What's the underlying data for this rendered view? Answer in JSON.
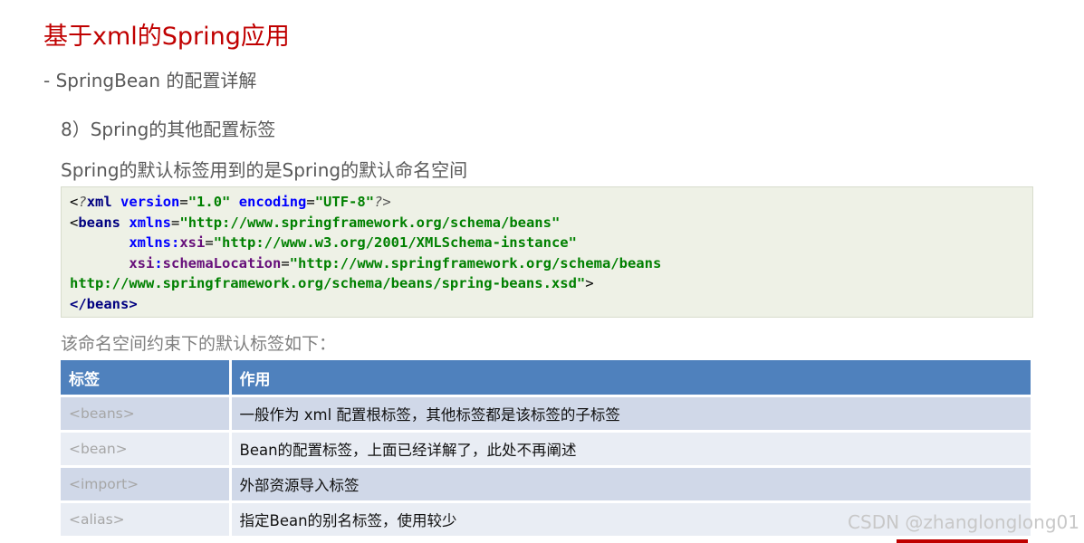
{
  "title": "基于xml的Spring应用",
  "subtitle": "- SpringBean 的配置详解",
  "section_item": "8）Spring的其他配置标签",
  "description": "Spring的默认标签用到的是Spring的默认命名空间",
  "code": {
    "line1": {
      "open": "<",
      "pi": "?",
      "name": "xml",
      "attr1": "version",
      "val1": "\"1.0\"",
      "attr2": "encoding",
      "val2": "\"UTF-8\"",
      "close": "?>"
    },
    "line2": {
      "open": "<",
      "name": "beans",
      "attr": "xmlns",
      "eq": "=",
      "val": "\"http://www.springframework.org/schema/beans\""
    },
    "line3": {
      "indent": "       ",
      "prefix": "xmlns",
      "colon": ":",
      "local": "xsi",
      "eq": "=",
      "val": "\"http://www.w3.org/2001/XMLSchema-instance\""
    },
    "line4": {
      "indent": "       ",
      "prefix": "xsi",
      "colon": ":",
      "local": "schemaLocation",
      "eq": "=",
      "val": "\"http://www.springframework.org/schema/beans"
    },
    "line5": {
      "val": "http://www.springframework.org/schema/beans/spring-beans.xsd\"",
      "close": ">"
    },
    "line6": {
      "tag": "</beans>"
    }
  },
  "table_caption": "该命名空间约束下的默认标签如下：",
  "table": {
    "headers": [
      "标签",
      "作用"
    ],
    "rows": [
      [
        "<beans>",
        "一般作为 xml 配置根标签，其他标签都是该标签的子标签"
      ],
      [
        "<bean>",
        "Bean的配置标签，上面已经详解了，此处不再阐述"
      ],
      [
        "<import>",
        "外部资源导入标签"
      ],
      [
        "<alias>",
        "指定Bean的别名标签，使用较少"
      ]
    ]
  },
  "watermark": "CSDN @zhanglonglong01",
  "colors": {
    "title": "#c00000",
    "table_header": "#4f81bd",
    "row_odd": "#d0d8e8",
    "row_even": "#e9edf4",
    "code_background": "#eef1e6"
  }
}
